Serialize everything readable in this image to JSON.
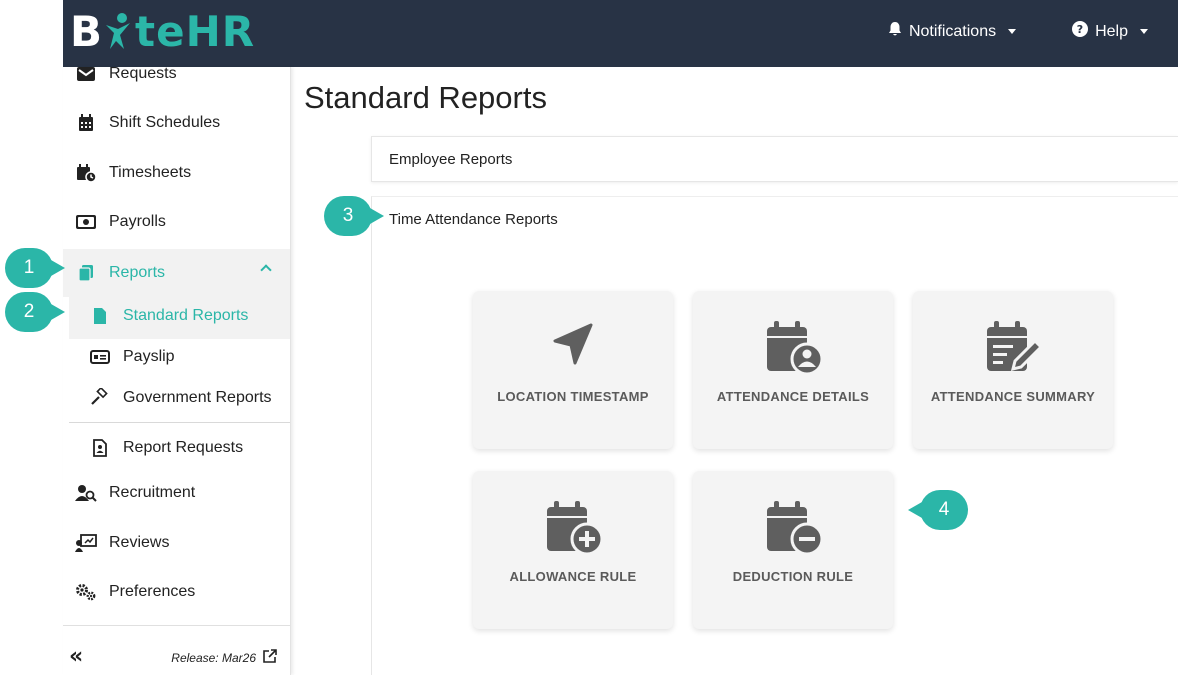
{
  "brand": {
    "part1": "B",
    "part2": "te",
    "part3": "HR"
  },
  "topbar": {
    "notifications_label": "Notifications",
    "help_label": "Help"
  },
  "sidebar": {
    "requests": "Requests",
    "shift_schedules": "Shift Schedules",
    "timesheets": "Timesheets",
    "payrolls": "Payrolls",
    "reports": "Reports",
    "standard_reports": "Standard Reports",
    "payslip": "Payslip",
    "government_reports": "Government Reports",
    "report_requests": "Report Requests",
    "recruitment": "Recruitment",
    "reviews": "Reviews",
    "preferences": "Preferences",
    "collapse_symbol": "«",
    "release": "Release: Mar26"
  },
  "main": {
    "title": "Standard Reports",
    "sections": [
      {
        "label": "Employee Reports"
      },
      {
        "label": "Time Attendance Reports"
      }
    ],
    "cards": [
      {
        "label": "LOCATION TIMESTAMP",
        "icon": "location-arrow-icon"
      },
      {
        "label": "ATTENDANCE DETAILS",
        "icon": "calendar-user-icon"
      },
      {
        "label": "ATTENDANCE SUMMARY",
        "icon": "calendar-edit-icon"
      },
      {
        "label": "ALLOWANCE RULE",
        "icon": "calendar-plus-icon"
      },
      {
        "label": "DEDUCTION RULE",
        "icon": "calendar-minus-icon"
      }
    ]
  },
  "callouts": [
    "1",
    "2",
    "3",
    "4"
  ],
  "colors": {
    "accent": "#2bb6a8",
    "topbar": "#283345",
    "card_bg": "#f4f4f4",
    "icon": "#5f5f5f"
  }
}
